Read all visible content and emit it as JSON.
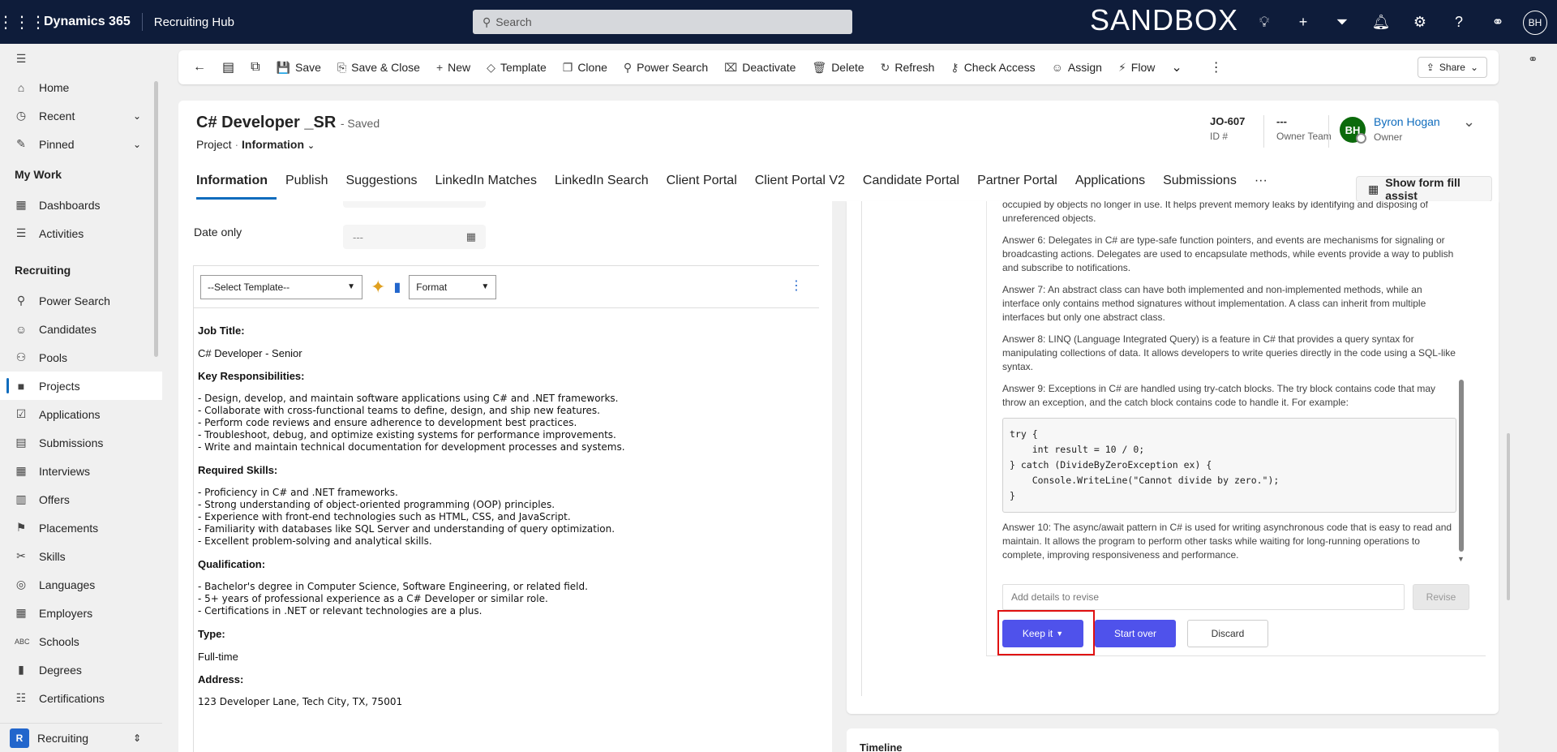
{
  "topbar": {
    "brand": "Dynamics 365",
    "app": "Recruiting Hub",
    "search_placeholder": "Search",
    "environment": "SANDBOX",
    "user_initials": "BH"
  },
  "sidebar": {
    "items_top": [
      {
        "label": "Home",
        "icon": "⌂"
      },
      {
        "label": "Recent",
        "icon": "◷",
        "chevron": true
      },
      {
        "label": "Pinned",
        "icon": "✎",
        "chevron": true
      }
    ],
    "section_mywork": "My Work",
    "items_mywork": [
      {
        "label": "Dashboards",
        "icon": "▦"
      },
      {
        "label": "Activities",
        "icon": "☰"
      }
    ],
    "section_recruiting": "Recruiting",
    "items_recruiting": [
      {
        "label": "Power Search",
        "icon": "⚲"
      },
      {
        "label": "Candidates",
        "icon": "☺"
      },
      {
        "label": "Pools",
        "icon": "⚇"
      },
      {
        "label": "Projects",
        "icon": "■",
        "active": true
      },
      {
        "label": "Applications",
        "icon": "☑"
      },
      {
        "label": "Submissions",
        "icon": "▤"
      },
      {
        "label": "Interviews",
        "icon": "▦"
      },
      {
        "label": "Offers",
        "icon": "▥"
      },
      {
        "label": "Placements",
        "icon": "⚑"
      },
      {
        "label": "Skills",
        "icon": "✂"
      },
      {
        "label": "Languages",
        "icon": "◎"
      },
      {
        "label": "Employers",
        "icon": "▦"
      },
      {
        "label": "Schools",
        "icon": "ABC"
      },
      {
        "label": "Degrees",
        "icon": "▮"
      },
      {
        "label": "Certifications",
        "icon": "☷"
      }
    ],
    "footer_badge": "R",
    "footer_label": "Recruiting"
  },
  "commands": [
    {
      "label": "Save",
      "icon": "💾"
    },
    {
      "label": "Save & Close",
      "icon": "⎘"
    },
    {
      "label": "New",
      "icon": "+"
    },
    {
      "label": "Template",
      "icon": "◇"
    },
    {
      "label": "Clone",
      "icon": "❐"
    },
    {
      "label": "Power Search",
      "icon": "⚲"
    },
    {
      "label": "Deactivate",
      "icon": "⌧"
    },
    {
      "label": "Delete",
      "icon": "🗑"
    },
    {
      "label": "Refresh",
      "icon": "↻"
    },
    {
      "label": "Check Access",
      "icon": "⚷"
    },
    {
      "label": "Assign",
      "icon": "☺"
    },
    {
      "label": "Flow",
      "icon": "⚡"
    }
  ],
  "share_label": "Share",
  "record": {
    "title": "C# Developer _SR",
    "saved": "- Saved",
    "entity": "Project",
    "form": "Information",
    "id_value": "JO-607",
    "id_label": "ID #",
    "owner_team_value": "---",
    "owner_team_label": "Owner Team",
    "owner_name": "Byron Hogan",
    "owner_label": "Owner",
    "owner_initials": "BH"
  },
  "tabs": [
    "Information",
    "Publish",
    "Suggestions",
    "LinkedIn Matches",
    "LinkedIn Search",
    "Client Portal",
    "Client Portal V2",
    "Candidate Portal",
    "Partner Portal",
    "Applications",
    "Submissions",
    "···"
  ],
  "form_fill_assist": "Show form fill assist",
  "fields": {
    "date_only_label": "Date only",
    "date_only_value": "---"
  },
  "editor": {
    "template_select": "--Select Template--",
    "format_select": "Format",
    "job_title_heading": "Job Title:",
    "job_title": "C# Developer - Senior",
    "resp_heading": "Key Responsibilities:",
    "responsibilities": [
      "- Design, develop, and maintain software applications using C# and .NET frameworks.",
      "- Collaborate with cross-functional teams to define, design, and ship new features.",
      "- Perform code reviews and ensure adherence to development best practices.",
      "- Troubleshoot, debug, and optimize existing systems for performance improvements.",
      "- Write and maintain technical documentation for development processes and systems."
    ],
    "skills_heading": "Required Skills:",
    "skills": [
      "- Proficiency in C# and .NET frameworks.",
      "- Strong understanding of object-oriented programming (OOP) principles.",
      "- Experience with front-end technologies such as HTML, CSS, and JavaScript.",
      "- Familiarity with databases like SQL Server and understanding of query optimization.",
      "- Excellent problem-solving and analytical skills."
    ],
    "qual_heading": "Qualification:",
    "qualifications": [
      "- Bachelor's degree in Computer Science, Software Engineering, or related field.",
      "- 5+ years of professional experience as a C# Developer or similar role.",
      "- Certifications in .NET or relevant technologies are a plus."
    ],
    "type_heading": "Type:",
    "type": "Full-time",
    "address_heading": "Address:",
    "address": "123 Developer Lane, Tech City, TX, 75001"
  },
  "copilot": {
    "answer5_tail": "occupied by objects no longer in use. It helps prevent memory leaks by identifying and disposing of unreferenced objects.",
    "answer6": "Answer 6: Delegates in C# are type-safe function pointers, and events are mechanisms for signaling or broadcasting actions. Delegates are used to encapsulate methods, while events provide a way to publish and subscribe to notifications.",
    "answer7": "Answer 7: An abstract class can have both implemented and non-implemented methods, while an interface only contains method signatures without implementation. A class can inherit from multiple interfaces but only one abstract class.",
    "answer8": "Answer 8: LINQ (Language Integrated Query) is a feature in C# that provides a query syntax for manipulating collections of data. It allows developers to write queries directly in the code using a SQL-like syntax.",
    "answer9": "Answer 9: Exceptions in C# are handled using try-catch blocks. The try block contains code that may throw an exception, and the catch block contains code to handle it. For example:",
    "code": "try {\n    int result = 10 / 0;\n} catch (DivideByZeroException ex) {\n    Console.WriteLine(\"Cannot divide by zero.\");\n}",
    "answer10": "Answer 10: The async/await pattern in C# is used for writing asynchronous code that is easy to read and maintain. It allows the program to perform other tasks while waiting for long-running operations to complete, improving responsiveness and performance.",
    "revise_placeholder": "Add details to revise",
    "revise_button": "Revise",
    "keep_button": "Keep it",
    "startover_button": "Start over",
    "discard_button": "Discard"
  },
  "timeline_label": "Timeline",
  "colors": {
    "topbar": "#0e1c3a",
    "accent": "#0f6cbd",
    "copilot_button": "#4f52eb",
    "highlight": "#e01010"
  }
}
